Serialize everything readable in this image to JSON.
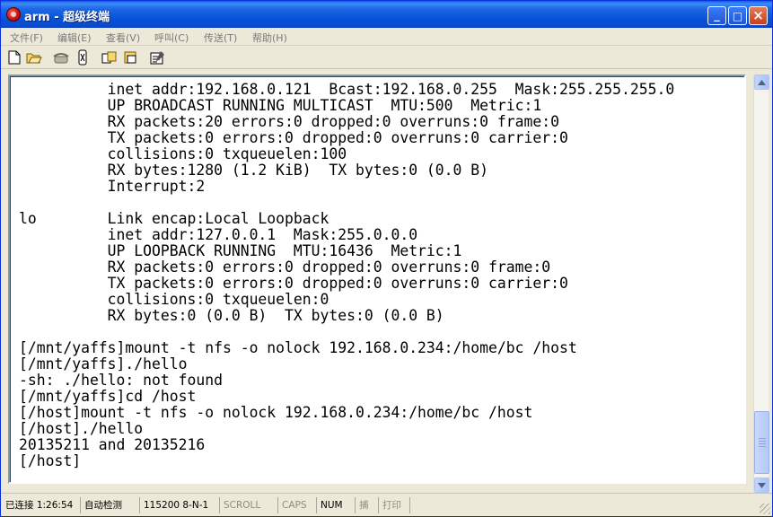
{
  "window": {
    "title": "arm - 超级终端",
    "controls": {
      "minimize": "_",
      "maximize": "□",
      "close": "×"
    }
  },
  "menu": [
    "文件(F)",
    "编辑(E)",
    "查看(V)",
    "呼叫(C)",
    "传送(T)",
    "帮助(H)"
  ],
  "toolbar": {
    "icons": [
      "new-file-icon",
      "open-folder-icon",
      "phone-call-icon",
      "disconnect-icon",
      "send-icon",
      "receive-icon",
      "properties-icon"
    ]
  },
  "terminal": {
    "lines": [
      "          inet addr:192.168.0.121  Bcast:192.168.0.255  Mask:255.255.255.0",
      "          UP BROADCAST RUNNING MULTICAST  MTU:500  Metric:1",
      "          RX packets:20 errors:0 dropped:0 overruns:0 frame:0",
      "          TX packets:0 errors:0 dropped:0 overruns:0 carrier:0",
      "          collisions:0 txqueuelen:100",
      "          RX bytes:1280 (1.2 KiB)  TX bytes:0 (0.0 B)",
      "          Interrupt:2",
      "",
      "lo        Link encap:Local Loopback",
      "          inet addr:127.0.0.1  Mask:255.0.0.0",
      "          UP LOOPBACK RUNNING  MTU:16436  Metric:1",
      "          RX packets:0 errors:0 dropped:0 overruns:0 frame:0",
      "          TX packets:0 errors:0 dropped:0 overruns:0 carrier:0",
      "          collisions:0 txqueuelen:0",
      "          RX bytes:0 (0.0 B)  TX bytes:0 (0.0 B)",
      "",
      "[/mnt/yaffs]mount -t nfs -o nolock 192.168.0.234:/home/bc /host",
      "[/mnt/yaffs]./hello",
      "-sh: ./hello: not found",
      "[/mnt/yaffs]cd /host",
      "[/host]mount -t nfs -o nolock 192.168.0.234:/home/bc /host",
      "[/host]./hello",
      "20135211 and 20135216",
      "[/host]"
    ]
  },
  "status": {
    "connection": "已连接 1:26:54",
    "detect": "自动检测",
    "port_settings": "115200 8-N-1",
    "scroll": "SCROLL",
    "caps": "CAPS",
    "num": "NUM",
    "capture": "捕",
    "print": "打印"
  }
}
